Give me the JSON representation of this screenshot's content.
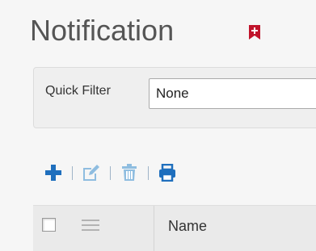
{
  "header": {
    "title": "Notification",
    "bookmark_icon": "bookmark-plus-icon",
    "bookmark_color": "#c0142b"
  },
  "filter": {
    "label": "Quick Filter",
    "value": "None"
  },
  "toolbar": {
    "items": [
      {
        "icon": "plus-icon",
        "color": "#1f6fbd",
        "enabled": true
      },
      {
        "icon": "edit-icon",
        "color": "#8fbde0",
        "enabled": false
      },
      {
        "icon": "trash-icon",
        "color": "#8fbde0",
        "enabled": false
      },
      {
        "icon": "print-icon",
        "color": "#1f6fbd",
        "enabled": true
      }
    ]
  },
  "grid": {
    "columns": [
      {
        "key": "select",
        "label": ""
      },
      {
        "key": "name",
        "label": "Name"
      }
    ]
  }
}
